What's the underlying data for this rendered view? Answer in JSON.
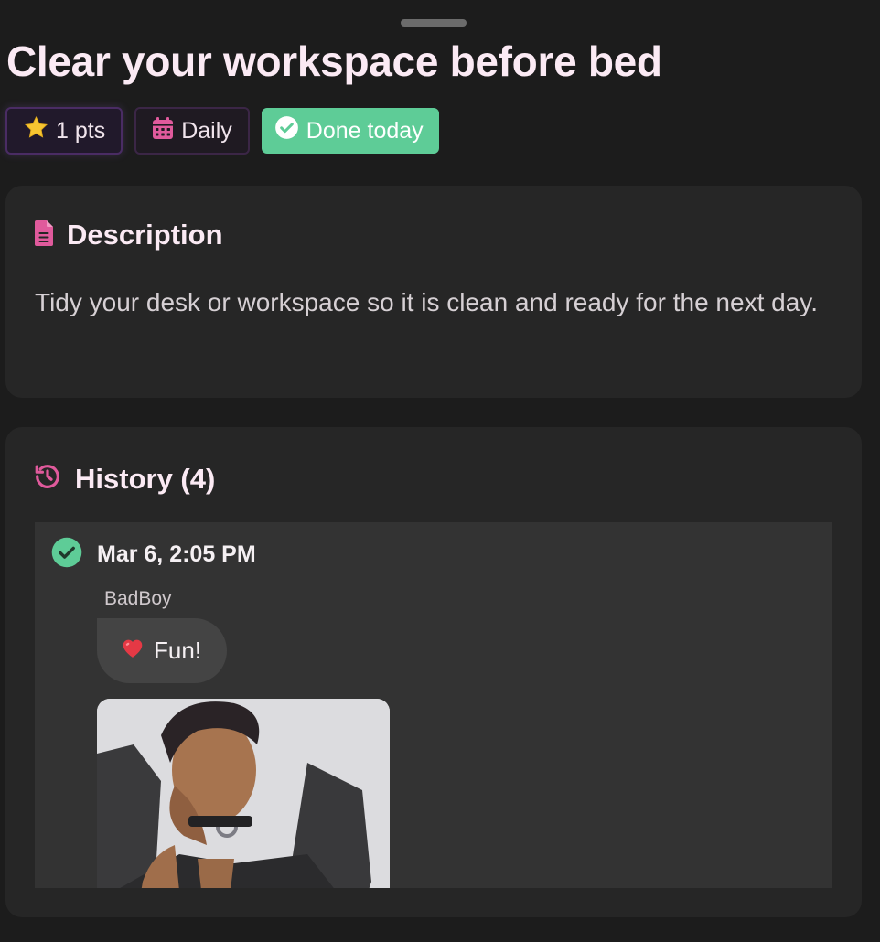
{
  "task": {
    "title": "Clear your workspace before bed"
  },
  "chips": {
    "points_label": "1 pts",
    "frequency_label": "Daily",
    "status_label": "Done today"
  },
  "description": {
    "heading": "Description",
    "text": "Tidy your desk or workspace so it is clean and ready for the next day."
  },
  "history": {
    "heading": "History (4)",
    "entries": [
      {
        "date": "Mar 6, 2:05 PM",
        "user": "BadBoy",
        "reaction": "Fun!"
      }
    ]
  },
  "colors": {
    "accent_pink": "#e05a9c",
    "done_green": "#5ecc97",
    "star_yellow": "#f7c531"
  },
  "icons": {
    "points": "star-icon",
    "frequency": "calendar-icon",
    "status": "check-circle-icon",
    "description": "document-icon",
    "history": "history-icon",
    "entry_status": "check-circle-icon",
    "reaction": "heart-icon"
  }
}
